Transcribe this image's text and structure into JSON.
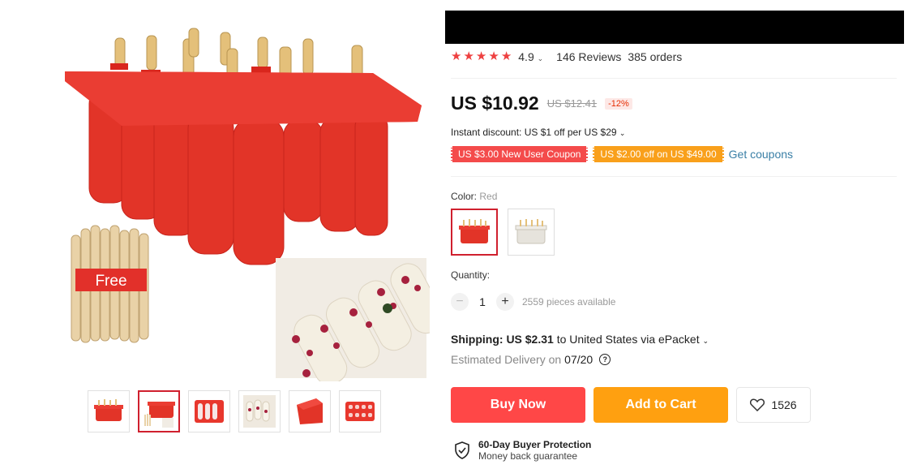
{
  "gallery": {
    "main_image": {
      "name": "popsicle-mold-main-image",
      "badge_text": "Free"
    },
    "thumbnails": [
      {
        "name": "thumb-1",
        "active": false
      },
      {
        "name": "thumb-2",
        "active": true
      },
      {
        "name": "thumb-3",
        "active": false
      },
      {
        "name": "thumb-4",
        "active": false
      },
      {
        "name": "thumb-5",
        "active": false
      },
      {
        "name": "thumb-6",
        "active": false
      }
    ]
  },
  "product": {
    "rating": {
      "value": "4.9",
      "reviews": "146 Reviews",
      "orders": "385 orders",
      "stars": 5
    },
    "price": {
      "current": "US $10.92",
      "original": "US $12.41",
      "discount": "-12%"
    },
    "instant_discount": "Instant discount: US $1 off per US $29",
    "coupons": [
      {
        "label": "US $3.00 New User Coupon",
        "color": "#f44b4b"
      },
      {
        "label": "US $2.00 off on US $49.00",
        "color": "#f9a01b"
      }
    ],
    "get_coupons": "Get coupons",
    "color": {
      "label": "Color:",
      "value": "Red",
      "options": [
        "Red",
        "White"
      ]
    },
    "quantity": {
      "label": "Quantity:",
      "value": "1",
      "available": "2559 pieces available"
    },
    "shipping": {
      "label": "Shipping:",
      "price": "US $2.31",
      "destination": "to United States via ePacket"
    },
    "delivery": {
      "label": "Estimated Delivery on",
      "date": "07/20"
    },
    "actions": {
      "buy_now": "Buy Now",
      "add_to_cart": "Add to Cart",
      "wishlist_count": "1526"
    },
    "protection": {
      "title": "60-Day Buyer Protection",
      "subtitle": "Money back guarantee"
    }
  },
  "colors": {
    "accent_red": "#ff4747",
    "accent_orange": "#ffa010",
    "star": "#ee4040",
    "link": "#3a7fa6"
  }
}
